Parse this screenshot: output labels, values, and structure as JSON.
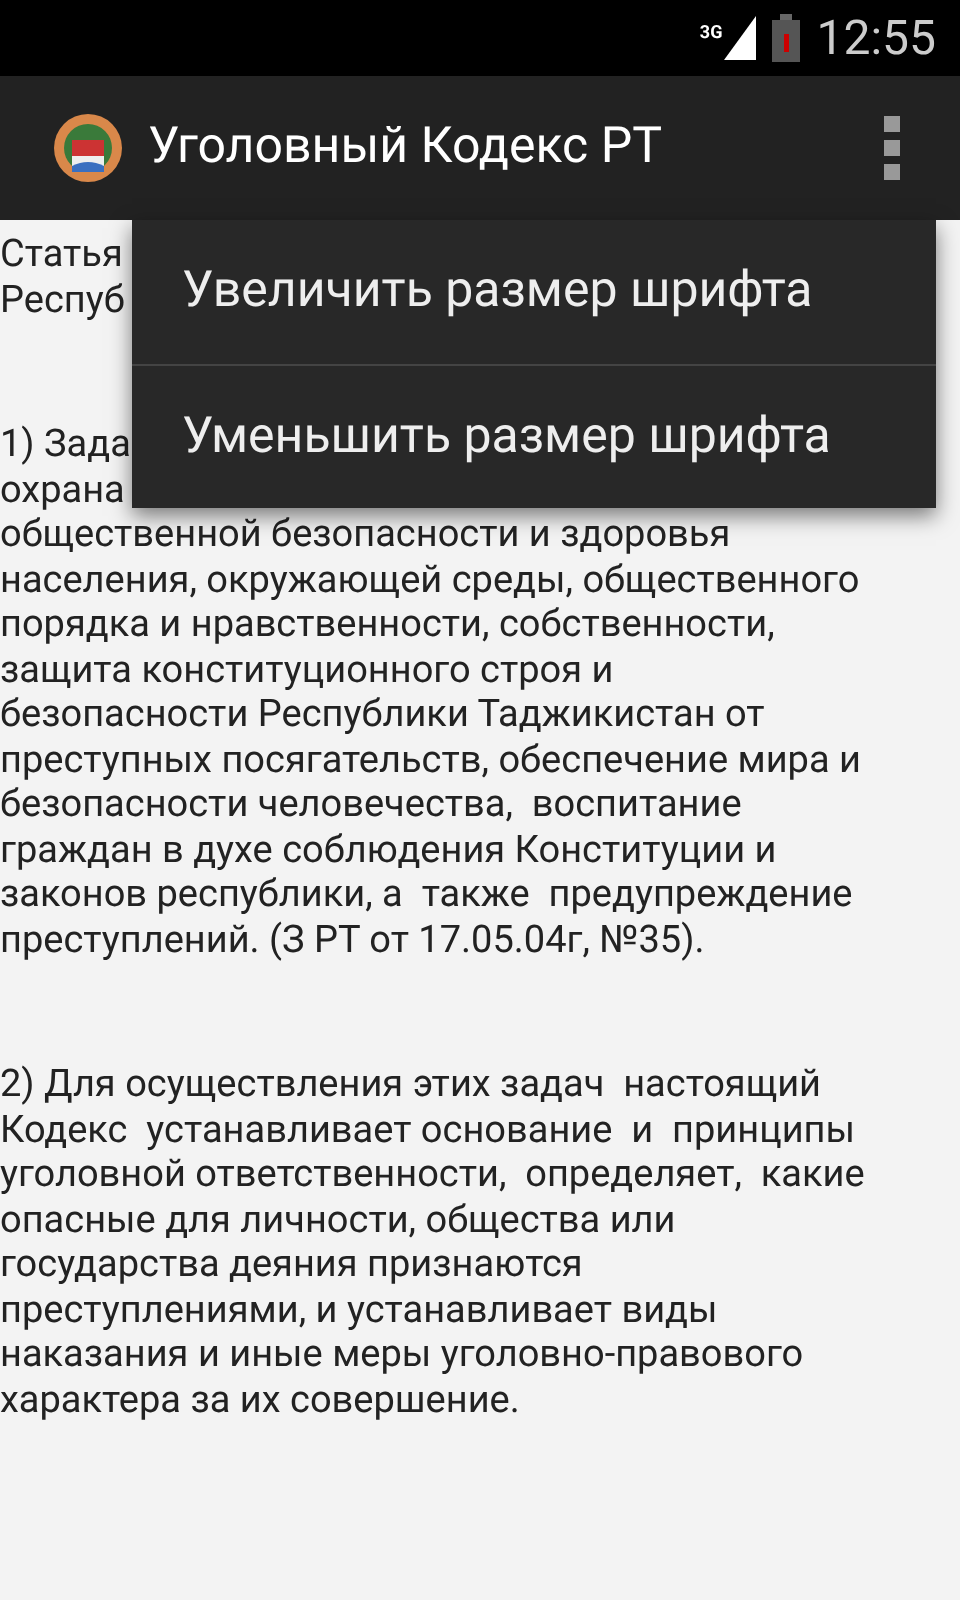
{
  "status_bar": {
    "network": "3G",
    "time": "12:55"
  },
  "action_bar": {
    "title": "Уголовный Кодекс РТ"
  },
  "paragraphs": [
    {
      "lines": [
        "Статья",
        "Респуб"
      ]
    },
    {
      "lines": [
        "1) Зада",
        "охрана",
        "общественной безопасности и здоровья",
        "населения, окружающей среды, общественного",
        "порядка и нравственности, собственности,",
        "защита конституционного строя и",
        "безопасности Республики Таджикистан от",
        "преступных посягательств, обеспечение мира и",
        "безопасности человечества,  воспитание",
        "граждан в духе соблюдения Конституции и",
        "законов республики, а  также  предупреждение",
        "преступлений. (З РТ от 17.05.04г, №35)."
      ]
    },
    {
      "lines": [
        "2) Для осуществления этих задач  настоящий",
        "Кодекс  устанавливает основание  и  принципы",
        "уголовной ответственности,  определяет,  какие",
        "опасные для личности, общества или",
        "государства деяния признаются",
        "преступлениями, и устанавливает виды",
        "наказания и иные меры уголовно-правового",
        "характера за их совершение."
      ]
    }
  ],
  "menu": {
    "items": [
      "Увеличить размер шрифта",
      "Уменьшить размер шрифта"
    ]
  }
}
